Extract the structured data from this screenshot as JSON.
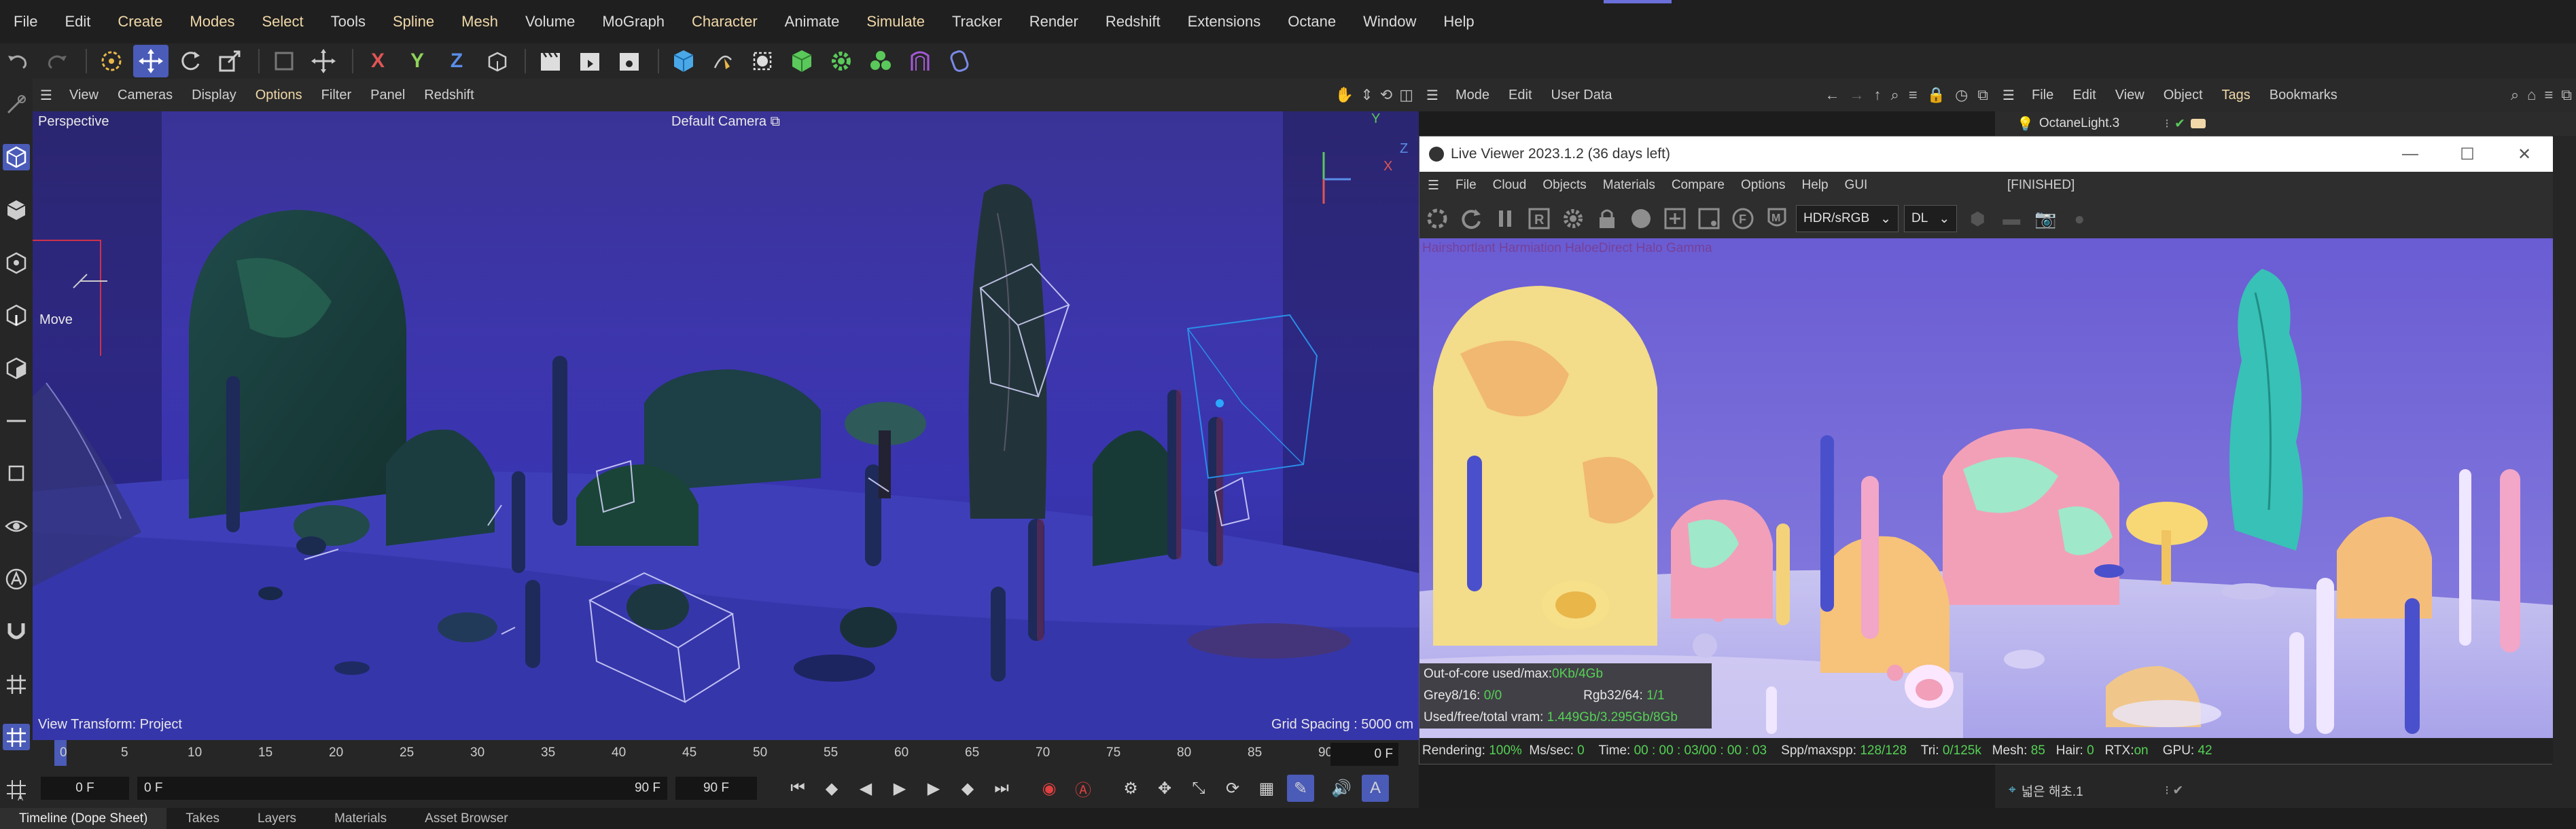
{
  "menubar": {
    "items": [
      "File",
      "Edit",
      "Create",
      "Modes",
      "Select",
      "Tools",
      "Spline",
      "Mesh",
      "Volume",
      "MoGraph",
      "Character",
      "Animate",
      "Simulate",
      "Tracker",
      "Render",
      "Redshift",
      "Extensions",
      "Octane",
      "Window",
      "Help"
    ]
  },
  "toolbar": {
    "axis_x": "X",
    "axis_y": "Y",
    "axis_z": "Z"
  },
  "viewport": {
    "menu": [
      "View",
      "Cameras",
      "Display",
      "Options",
      "Filter",
      "Panel",
      "Redshift"
    ],
    "view_name": "Perspective",
    "camera": "Default Camera",
    "move_label": "Move",
    "view_transform": "View Transform: Project",
    "grid_spacing": "Grid Spacing : 5000 cm",
    "axis_labels": {
      "y": "Y",
      "z": "Z",
      "x": "X"
    }
  },
  "timeline": {
    "ticks": [
      "0",
      "5",
      "10",
      "15",
      "20",
      "25",
      "30",
      "35",
      "40",
      "45",
      "50",
      "55",
      "60",
      "65",
      "70",
      "75",
      "80",
      "85",
      "90"
    ],
    "current_frame": "0 F"
  },
  "transport": {
    "start": "0 F",
    "range_start": "0 F",
    "range_end": "90 F",
    "end": "90 F"
  },
  "bottom_tabs": [
    "Timeline (Dope Sheet)",
    "Takes",
    "Layers",
    "Materials",
    "Asset Browser"
  ],
  "attributes": {
    "menu": [
      "Mode",
      "Edit",
      "User Data"
    ]
  },
  "objects": {
    "menu": [
      "File",
      "Edit",
      "View",
      "Object",
      "Tags",
      "Bookmarks"
    ],
    "top_object": "OctaneLight.3",
    "bottom_object": "넓은 해초.1"
  },
  "live_viewer": {
    "title": "Live Viewer 2023.1.2 (36 days left)",
    "menu": [
      "File",
      "Cloud",
      "Objects",
      "Materials",
      "Compare",
      "Options",
      "Help",
      "GUI"
    ],
    "status": "[FINISHED]",
    "color_space": "HDR/sRGB",
    "kernel": "DL",
    "overlay_note": "Hairshortlant  Harmiation HaloeDirect Halo Gamma",
    "info": {
      "out_of_core_label": "Out-of-core used/max:",
      "out_of_core_value": "0Kb/4Gb",
      "grey_label": "Grey8/16:",
      "grey_value": "0/0",
      "rgb_label": "Rgb32/64:",
      "rgb_value": "1/1",
      "vram_label": "Used/free/total vram:",
      "vram_value": "1.449Gb/3.295Gb/8Gb"
    },
    "statusbar": {
      "rendering_label": "Rendering:",
      "rendering_value": "100%",
      "ms_label": "Ms/sec:",
      "ms_value": "0",
      "time_label": "Time:",
      "time_value": "00 : 00 : 03/00 : 00 : 03",
      "spp_label": "Spp/maxspp:",
      "spp_value": "128/128",
      "tri_label": "Tri:",
      "tri_value": "0/125k",
      "mesh_label": "Mesh:",
      "mesh_value": "85",
      "hair_label": "Hair:",
      "hair_value": "0",
      "rtx_label": "RTX:",
      "rtx_value": "on",
      "gpu_label": "GPU:",
      "gpu_value": "42"
    }
  },
  "colors": {
    "accent": "#4a5bb8",
    "highlight_menu": "#f0d8a8",
    "status_green": "#55d155"
  }
}
